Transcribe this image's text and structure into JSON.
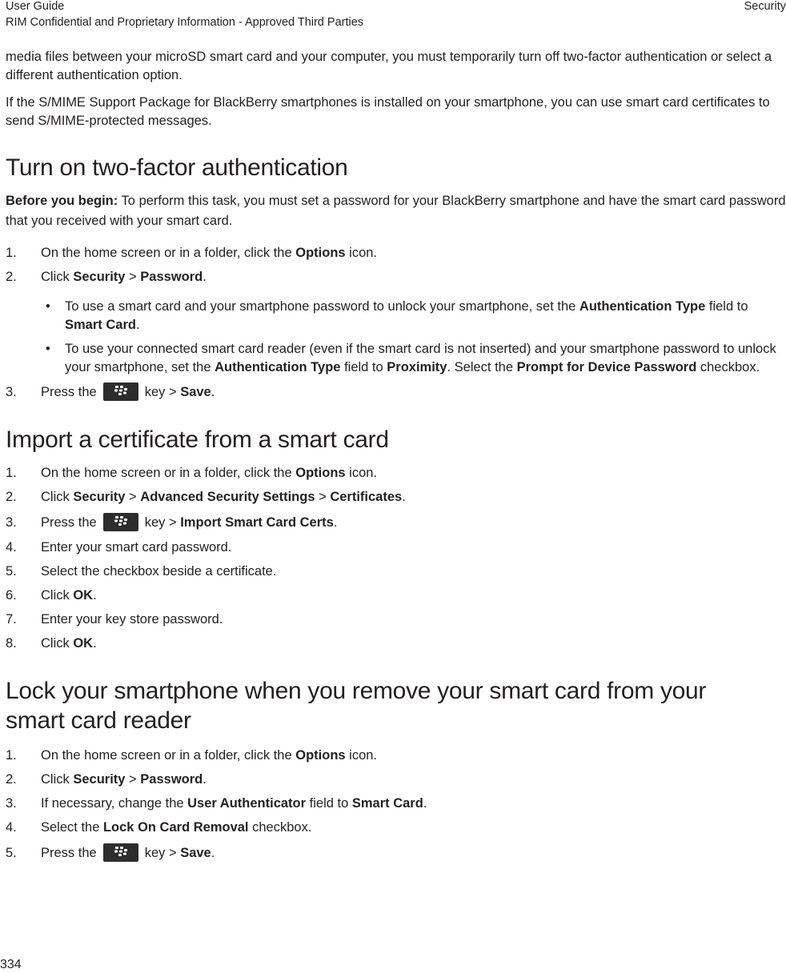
{
  "header": {
    "title": "User Guide",
    "confidentiality": "RIM Confidential and Proprietary Information - Approved Third Parties",
    "section": "Security"
  },
  "intro": {
    "p1": "media files between your microSD smart card and your computer, you must temporarily turn off two-factor authentication or select a different authentication option.",
    "p2": "If the S/MIME Support Package for BlackBerry smartphones is installed on your smartphone, you can use smart card certificates to send S/MIME-protected messages."
  },
  "section1": {
    "title": "Turn on two-factor authentication",
    "before_label": "Before you begin:",
    "before_text": " To perform this task, you must set a password for your BlackBerry smartphone and have the smart card password that you received with your smart card.",
    "step1": {
      "num": "1.",
      "pre": "On the home screen or in a folder, click the ",
      "b1": "Options",
      "post": " icon."
    },
    "step2": {
      "num": "2.",
      "pre": "Click ",
      "b1": "Security",
      "mid": " > ",
      "b2": "Password",
      "post": "."
    },
    "bullet1": {
      "dot": "•",
      "pre": "To use a smart card and your smartphone password to unlock your smartphone, set the ",
      "b1": "Authentication Type",
      "mid": " field to ",
      "b2": "Smart Card",
      "post": "."
    },
    "bullet2": {
      "dot": "•",
      "pre": "To use your connected smart card reader (even if the smart card is not inserted) and your smartphone password to unlock your smartphone, set the ",
      "b1": "Authentication Type",
      "mid1": " field to ",
      "b2": "Proximity",
      "mid2": ". Select the ",
      "b3": "Prompt for Device Password",
      "post": " checkbox."
    },
    "step3": {
      "num": "3.",
      "pre": "Press the",
      "mid": "key > ",
      "b1": "Save",
      "post": "."
    }
  },
  "section2": {
    "title": "Import a certificate from a smart card",
    "step1": {
      "num": "1.",
      "pre": "On the home screen or in a folder, click the ",
      "b1": "Options",
      "post": " icon."
    },
    "step2": {
      "num": "2.",
      "pre": "Click ",
      "b1": "Security",
      "mid1": " > ",
      "b2": "Advanced Security Settings",
      "mid2": " > ",
      "b3": "Certificates",
      "post": "."
    },
    "step3": {
      "num": "3.",
      "pre": "Press the",
      "mid": "key > ",
      "b1": "Import Smart Card Certs",
      "post": "."
    },
    "step4": {
      "num": "4.",
      "text": "Enter your smart card password."
    },
    "step5": {
      "num": "5.",
      "text": "Select the checkbox beside a certificate."
    },
    "step6": {
      "num": "6.",
      "pre": "Click ",
      "b1": "OK",
      "post": "."
    },
    "step7": {
      "num": "7.",
      "text": "Enter your key store password."
    },
    "step8": {
      "num": "8.",
      "pre": "Click ",
      "b1": "OK",
      "post": "."
    }
  },
  "section3": {
    "title": "Lock your smartphone when you remove your smart card from your smart card reader",
    "step1": {
      "num": "1.",
      "pre": "On the home screen or in a folder, click the ",
      "b1": "Options",
      "post": " icon."
    },
    "step2": {
      "num": "2.",
      "pre": "Click ",
      "b1": "Security",
      "mid": " > ",
      "b2": "Password",
      "post": "."
    },
    "step3": {
      "num": "3.",
      "pre": "If necessary, change the ",
      "b1": "User Authenticator",
      "mid": " field to ",
      "b2": "Smart Card",
      "post": "."
    },
    "step4": {
      "num": "4.",
      "pre": "Select the ",
      "b1": "Lock On Card Removal",
      "post": " checkbox."
    },
    "step5": {
      "num": "5.",
      "pre": "Press the",
      "mid": "key > ",
      "b1": "Save",
      "post": "."
    }
  },
  "icons": {
    "menu_key": "blackberry-menu-key-icon"
  },
  "footer": {
    "page_number": "334"
  }
}
